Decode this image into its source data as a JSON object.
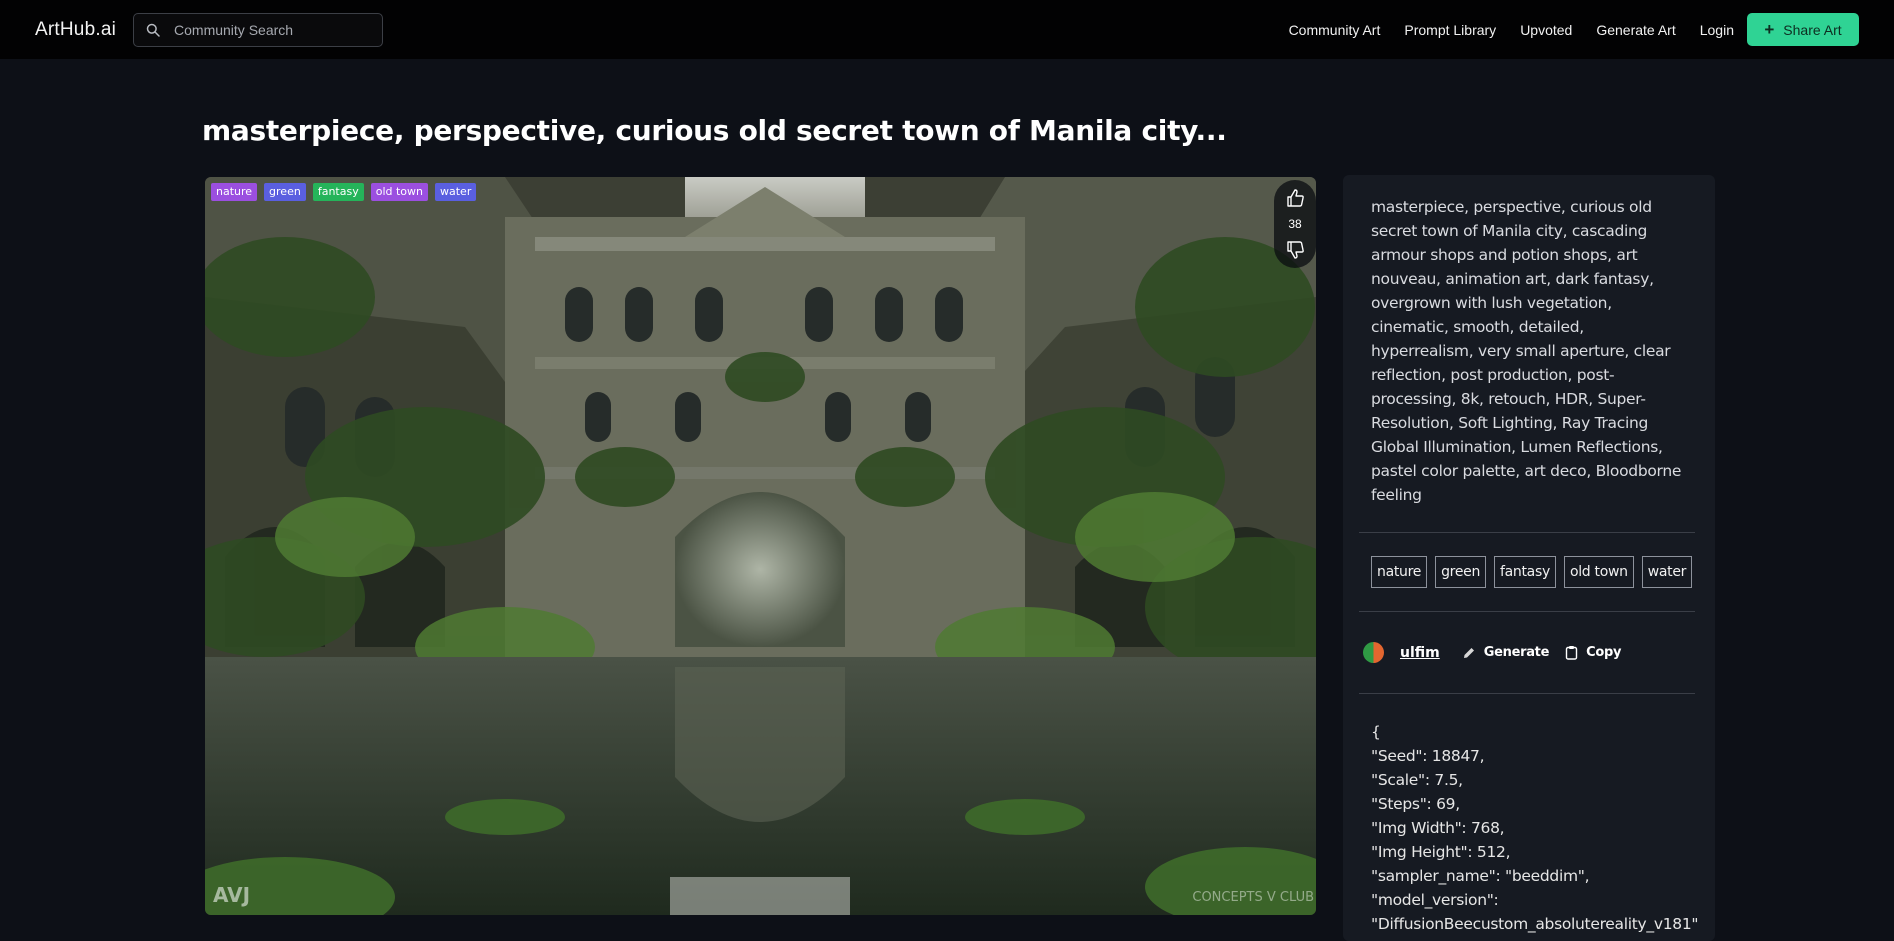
{
  "header": {
    "brand": "ArtHub.ai",
    "search_placeholder": "Community Search",
    "nav": [
      "Community Art",
      "Prompt Library",
      "Upvoted",
      "Generate Art",
      "Login"
    ],
    "share_label": "Share Art"
  },
  "page": {
    "title": "masterpiece, perspective, curious old secret town of Manila city..."
  },
  "image": {
    "tags": [
      {
        "label": "nature",
        "color": "#9b4fe0"
      },
      {
        "label": "green",
        "color": "#5a5fe0"
      },
      {
        "label": "fantasy",
        "color": "#25b45a"
      },
      {
        "label": "old town",
        "color": "#9b4fe0"
      },
      {
        "label": "water",
        "color": "#5a5fe0"
      }
    ],
    "votes": "38",
    "watermark_left": "AVJ",
    "watermark_right": "CONCEPTS V CLUB"
  },
  "panel": {
    "prompt": "masterpiece, perspective, curious old secret town of Manila city, cascading armour shops and potion shops, art nouveau, animation art, dark fantasy, overgrown with lush vegetation, cinematic, smooth, detailed, hyperrealism, very small aperture, clear reflection, post production, post-processing, 8k, retouch, HDR, Super-Resolution, Soft Lighting, Ray Tracing Global Illumination, Lumen Reflections, pastel color palette, art deco, Bloodborne feeling",
    "tags": [
      "nature",
      "green",
      "fantasy",
      "old town",
      "water"
    ],
    "author": "ulfim",
    "generate_label": "Generate",
    "copy_label": "Copy",
    "params_text": "{\n\"Seed\": 18847,\n\"Scale\": 7.5,\n\"Steps\": 69,\n\"Img Width\": 768,\n\"Img Height\": 512,\n\"sampler_name\": \"beeddim\",\n\"model_version\":\n\"DiffusionBeecustom_absolutereality_v181\"\n}"
  },
  "colors": {
    "accent": "#2fd394",
    "background": "#0d1017",
    "panel": "#161a22"
  }
}
